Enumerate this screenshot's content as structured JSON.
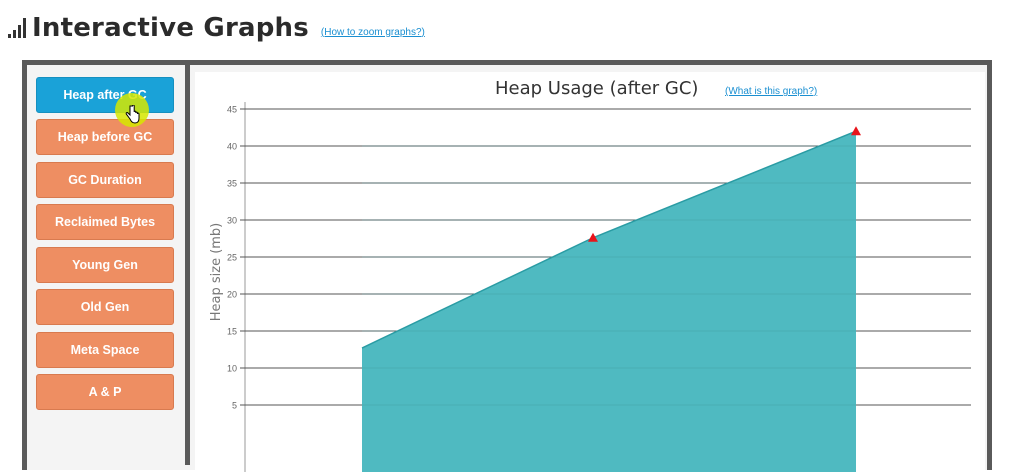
{
  "header": {
    "title": "Interactive Graphs",
    "zoom_link": "(How to zoom graphs?)"
  },
  "sidebar": {
    "items": [
      {
        "label": "Heap after GC",
        "active": true
      },
      {
        "label": "Heap before GC",
        "active": false
      },
      {
        "label": "GC Duration",
        "active": false
      },
      {
        "label": "Reclaimed Bytes",
        "active": false
      },
      {
        "label": "Young Gen",
        "active": false
      },
      {
        "label": "Old Gen",
        "active": false
      },
      {
        "label": "Meta Space",
        "active": false
      },
      {
        "label": "A & P",
        "active": false
      }
    ]
  },
  "chart_link": "(What is this graph?)",
  "colors": {
    "active_button": "#1aa2d8",
    "button": "#ee8e62",
    "area_fill": "#4fbac1",
    "area_line": "#2a9ca4",
    "marker": "#e8141b"
  },
  "chart_data": {
    "type": "area",
    "title": "Heap Usage (after GC)",
    "ylabel": "Heap size (mb)",
    "xlabel": "",
    "ylim": [
      0,
      45
    ],
    "yticks": [
      5,
      10,
      15,
      20,
      25,
      30,
      35,
      40,
      45
    ],
    "grid": true,
    "series": [
      {
        "points": [
          [
            0,
            12.7
          ],
          [
            1,
            27.6
          ],
          [
            2,
            42.0
          ]
        ],
        "markers": [
          false,
          true,
          true
        ]
      }
    ]
  }
}
